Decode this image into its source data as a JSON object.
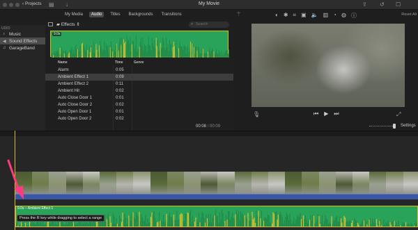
{
  "titlebar": {
    "back_label": "Projects",
    "window_title": "My Movie"
  },
  "media_tabs": [
    {
      "label": "My Media",
      "active": false
    },
    {
      "label": "Audio",
      "active": true
    },
    {
      "label": "Titles",
      "active": false
    },
    {
      "label": "Backgrounds",
      "active": false
    },
    {
      "label": "Transitions",
      "active": false
    }
  ],
  "reset_all_label": "Reset All",
  "sidebar": {
    "heading": "UDIO",
    "items": [
      {
        "label": "Music",
        "icon": "music-note-icon"
      },
      {
        "label": "Sound Effects",
        "icon": "speaker-icon",
        "selected": true
      },
      {
        "label": "GarageBand",
        "icon": "guitar-icon"
      }
    ]
  },
  "browser": {
    "category": "Effects",
    "search_placeholder": "Search",
    "preview_duration": "9.0s",
    "columns": {
      "name": "Name",
      "time": "Time",
      "genre": "Genre"
    },
    "rows": [
      {
        "name": "Alarm",
        "time": "0:05",
        "genre": ""
      },
      {
        "name": "Ambient Effect 1",
        "time": "0:09",
        "genre": "",
        "selected": true
      },
      {
        "name": "Ambient Effect 2",
        "time": "0:11",
        "genre": ""
      },
      {
        "name": "Ambient Hit",
        "time": "0:02",
        "genre": ""
      },
      {
        "name": "Auto Close Door 1",
        "time": "0:01",
        "genre": ""
      },
      {
        "name": "Auto Close Door 2",
        "time": "0:02",
        "genre": ""
      },
      {
        "name": "Auto Open Door 1",
        "time": "0:01",
        "genre": ""
      },
      {
        "name": "Auto Open Door 2",
        "time": "0:02",
        "genre": ""
      }
    ]
  },
  "time_readout": {
    "current": "00:08",
    "separator": "/",
    "total": "00:09"
  },
  "settings_label": "Settings",
  "timeline": {
    "clip_label": "9.0s – Ambient Effect 1",
    "tooltip": "Press the R key while dragging to select a range"
  },
  "colors": {
    "audio_green": "#2aa35a",
    "selection_yellow": "#d9b829",
    "video_audio_blue": "#3a57a6",
    "arrow_pink": "#ff3b7f"
  }
}
